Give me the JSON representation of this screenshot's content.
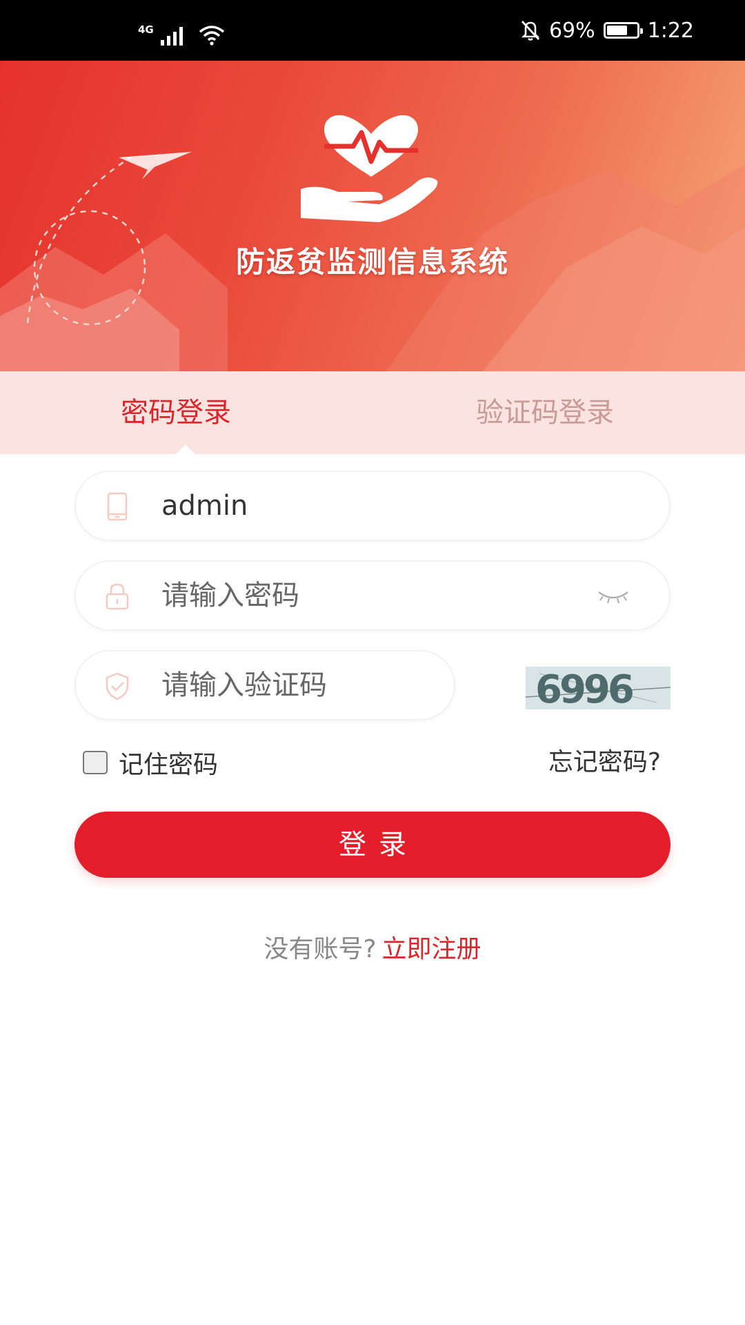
{
  "status_bar": {
    "network": "4G",
    "battery": "69%",
    "battery_level": 0.69,
    "time": "1:22"
  },
  "header": {
    "app_title": "防返贫监测信息系统",
    "logo": "heart-hand-logo"
  },
  "tabs": [
    {
      "label": "密码登录",
      "active": true
    },
    {
      "label": "验证码登录",
      "active": false
    }
  ],
  "form": {
    "username_value": "admin",
    "password_placeholder": "请输入密码",
    "captcha_placeholder": "请输入验证码",
    "captcha_image_text": "6996",
    "remember_label": "记住密码",
    "forgot_label": "忘记密码?",
    "login_label": "登录"
  },
  "register": {
    "prompt": "没有账号?",
    "link": "立即注册"
  },
  "colors": {
    "accent": "#e31d29",
    "tab_bg": "#fbe3e1",
    "inactive_tab": "#c99a96"
  },
  "icons": [
    "phone-icon",
    "lock-icon",
    "shield-icon",
    "eye-closed-icon",
    "signal-icon",
    "wifi-icon",
    "bell-off-icon",
    "battery-icon"
  ]
}
